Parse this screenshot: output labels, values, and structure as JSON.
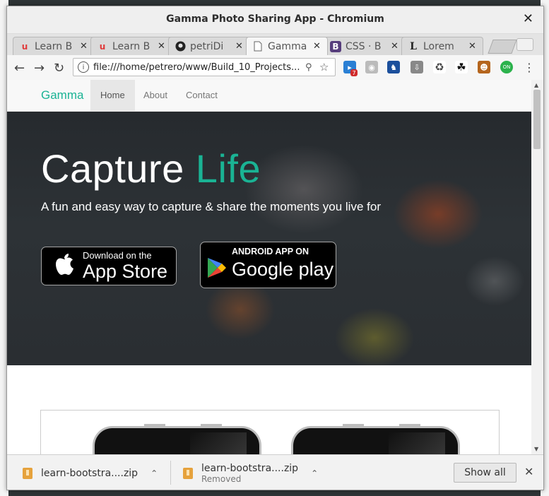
{
  "window": {
    "title": "Gamma Photo Sharing App - Chromium",
    "close": "✕"
  },
  "tabs": [
    {
      "label": "Learn B",
      "favicon": "u"
    },
    {
      "label": "Learn B",
      "favicon": "u"
    },
    {
      "label": "petriDi",
      "favicon": "gh"
    },
    {
      "label": "Gamma",
      "favicon": "doc"
    },
    {
      "label": "CSS · B",
      "favicon": "B"
    },
    {
      "label": "Lorem",
      "favicon": "L"
    }
  ],
  "toolbar": {
    "url": "file:///home/petrero/www/Build_10_Projects...",
    "extension_badge": "7"
  },
  "site": {
    "brand": "Gamma",
    "nav": [
      "Home",
      "About",
      "Contact"
    ],
    "hero_title_main": "Capture",
    "hero_title_accent": "Life",
    "hero_subtitle": "A fun and easy way to capture & share the moments you live for",
    "appstore_small": "Download on the",
    "appstore_big": "App Store",
    "googleplay_small": "ANDROID APP ON",
    "googleplay_big": "Google play"
  },
  "downloads": [
    {
      "name": "learn-bootstra....zip",
      "status": ""
    },
    {
      "name": "learn-bootstra....zip",
      "status": "Removed"
    }
  ],
  "shelf": {
    "show_all": "Show all"
  },
  "colors": {
    "accent": "#1ab394",
    "brand": "#1ab394"
  }
}
